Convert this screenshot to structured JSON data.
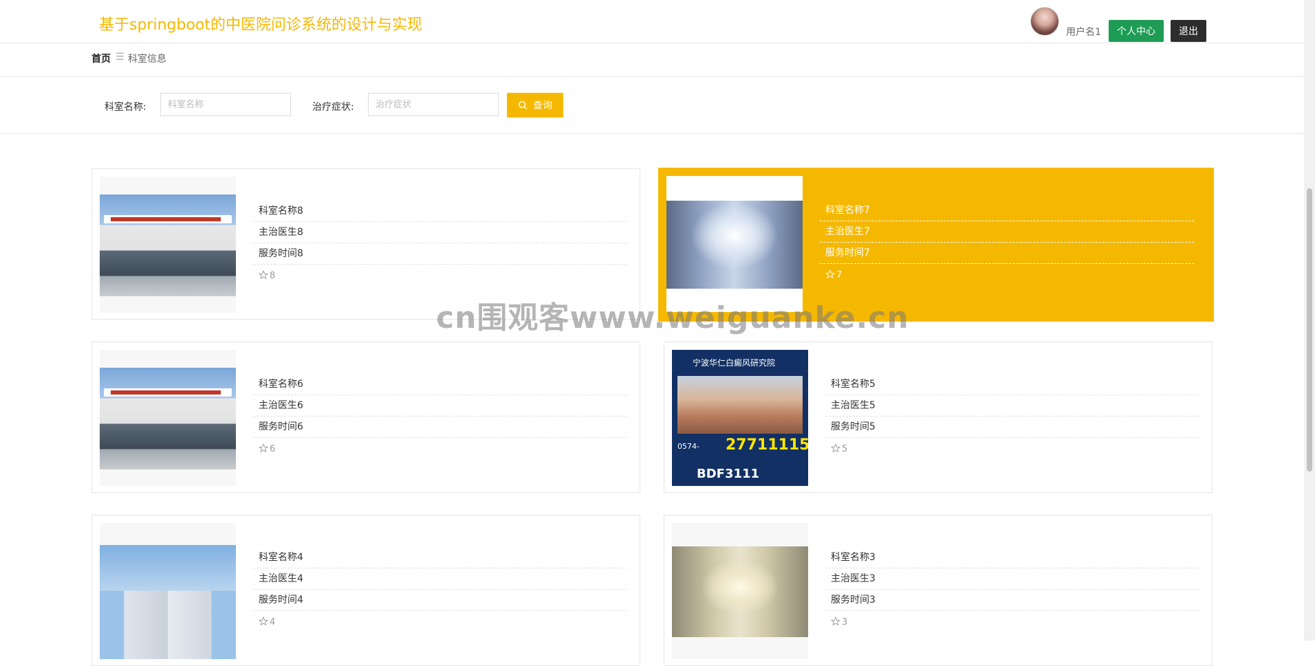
{
  "header": {
    "title": "基于springboot的中医院问诊系统的设计与实现",
    "username": "用户名1",
    "center_label": "个人中心",
    "logout_label": "退出"
  },
  "breadcrumb": {
    "home": "首页",
    "separator": "☰",
    "current": "科室信息"
  },
  "search": {
    "name_label": "科室名称:",
    "name_placeholder": "科室名称",
    "symptom_label": "治疗症状:",
    "symptom_placeholder": "治疗症状",
    "button_label": "查询"
  },
  "cards": [
    {
      "name": "科室名称8",
      "doctor": "主治医生8",
      "time": "服务时间8",
      "rating": "8"
    },
    {
      "name": "科室名称7",
      "doctor": "主治医生7",
      "time": "服务时间7",
      "rating": "7"
    },
    {
      "name": "科室名称6",
      "doctor": "主治医生6",
      "time": "服务时间6",
      "rating": "6"
    },
    {
      "name": "科室名称5",
      "doctor": "主治医生5",
      "time": "服务时间5",
      "rating": "5"
    },
    {
      "name": "科室名称4",
      "doctor": "主治医生4",
      "time": "服务时间4",
      "rating": "4"
    },
    {
      "name": "科室名称3",
      "doctor": "主治医生3",
      "time": "服务时间3",
      "rating": "3"
    }
  ],
  "research_image": {
    "title": "宁波华仁白癜风研究院",
    "phone_prefix": "0574-",
    "phone": "27711115",
    "wechat": "BDF3111"
  },
  "watermark": "cn围观客www.weiguanke.cn",
  "colors": {
    "accent": "#f5b800",
    "green": "#1e9b55",
    "dark": "#2d2d2d"
  }
}
